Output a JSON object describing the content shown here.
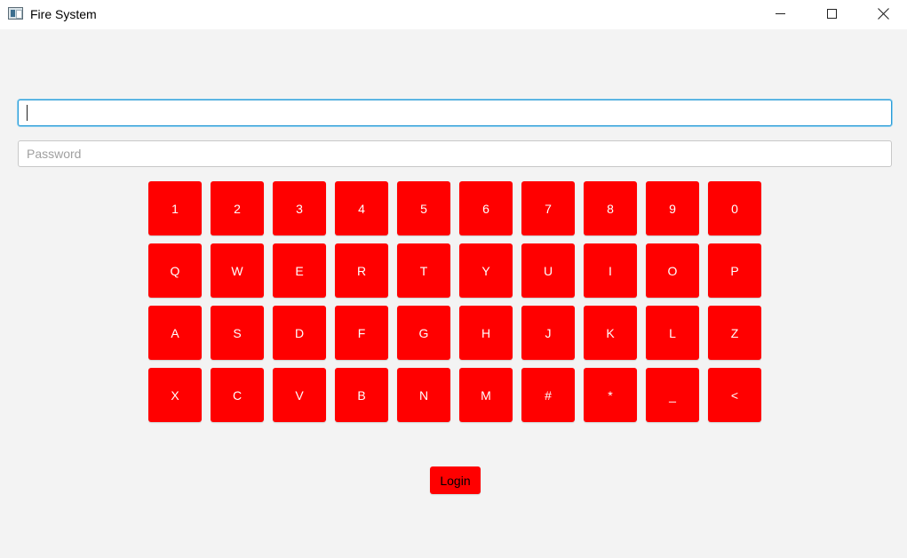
{
  "window": {
    "title": "Fire System",
    "icon": "app-window-icon",
    "controls": {
      "minimize_icon": "minimize-icon",
      "maximize_icon": "maximize-icon",
      "close_icon": "close-icon"
    }
  },
  "form": {
    "username": {
      "value": "",
      "placeholder": ""
    },
    "password": {
      "value": "",
      "placeholder": "Password"
    }
  },
  "keypad": {
    "rows": [
      [
        "1",
        "2",
        "3",
        "4",
        "5",
        "6",
        "7",
        "8",
        "9",
        "0"
      ],
      [
        "Q",
        "W",
        "E",
        "R",
        "T",
        "Y",
        "U",
        "I",
        "O",
        "P"
      ],
      [
        "A",
        "S",
        "D",
        "F",
        "G",
        "H",
        "J",
        "K",
        "L",
        "Z"
      ],
      [
        "X",
        "C",
        "V",
        "B",
        "N",
        "M",
        "#",
        "*",
        "_",
        "<"
      ]
    ]
  },
  "login_label": "Login",
  "colors": {
    "key_background": "#ff0000",
    "key_text": "#ffffff",
    "login_text": "#000000",
    "focus_border": "#2a9bd6",
    "window_background": "#f3f3f3"
  }
}
